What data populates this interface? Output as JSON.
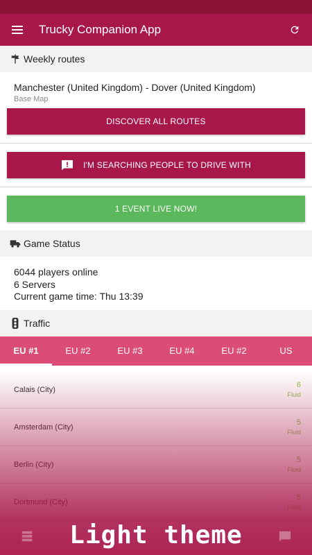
{
  "app": {
    "title": "Trucky Companion App"
  },
  "weekly_routes": {
    "header": "Weekly routes",
    "route_name": "Manchester (United Kingdom) - Dover (United Kingdom)",
    "route_sub": "Base Map",
    "discover_label": "DISCOVER ALL ROUTES"
  },
  "searching_label": "I'M SEARCHING PEOPLE TO DRIVE WITH",
  "event_label": "1 EVENT LIVE NOW!",
  "game_status": {
    "header": "Game Status",
    "players": "6044 players online",
    "servers": "6 Servers",
    "time": "Current game time:  Thu 13:39"
  },
  "traffic": {
    "header": "Traffic",
    "tabs": [
      "EU #1",
      "EU #2",
      "EU #3",
      "EU #4",
      "EU #2",
      "US"
    ],
    "rows": [
      {
        "city": "Calais (City)",
        "value": "6",
        "state": "Fluid"
      },
      {
        "city": "Amsterdam (City)",
        "value": "5",
        "state": "Fluid"
      },
      {
        "city": "Berlin (City)",
        "value": "5",
        "state": "Fluid"
      },
      {
        "city": "Dortmund (City)",
        "value": "5",
        "state": "Fluid"
      }
    ]
  },
  "banner": "Light theme",
  "colors": {
    "primary": "#a8174a",
    "status_bar": "#8e1238",
    "tabs": "#db4d76",
    "event": "#5cb85c",
    "fluid": "#8bc34a"
  }
}
